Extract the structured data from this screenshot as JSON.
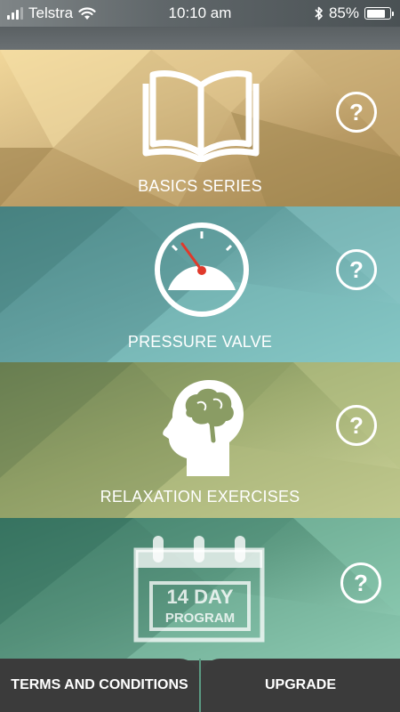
{
  "status_bar": {
    "carrier": "Telstra",
    "time": "10:10 am",
    "battery_percent": "85%",
    "battery_level": 0.85,
    "signal_bars_filled": 3,
    "signal_bars_total": 4
  },
  "panels": [
    {
      "label": "BASICS SERIES",
      "icon": "open-book-icon",
      "help": "?"
    },
    {
      "label": "PRESSURE VALVE",
      "icon": "pressure-gauge-icon",
      "help": "?"
    },
    {
      "label": "RELAXATION EXERCISES",
      "icon": "head-brain-icon",
      "help": "?"
    },
    {
      "label": "",
      "icon": "calendar-icon",
      "help": "?",
      "calendar_line1": "14 DAY",
      "calendar_line2": "PROGRAM"
    }
  ],
  "bottom_bar": {
    "terms_label": "TERMS AND CONDITIONS",
    "upgrade_label": "UPGRADE"
  },
  "colors": {
    "basics": "#d8bd86",
    "pressure": "#6aa7a7",
    "relaxation": "#9eac70",
    "program": "#5f9c84",
    "bottom_bar": "#3b3b3b",
    "needle": "#e0392b"
  }
}
